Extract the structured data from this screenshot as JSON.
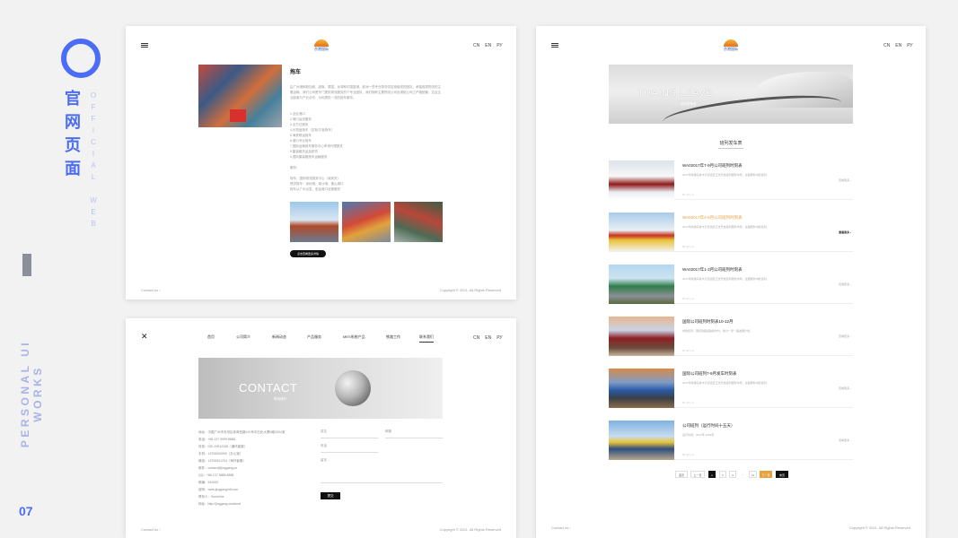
{
  "brand": {
    "cn_title": [
      "官",
      "网",
      "页",
      "面"
    ],
    "en_vertical": [
      "O",
      "F",
      "F",
      "I",
      "C",
      "I",
      "A",
      "L",
      "",
      "W",
      "E",
      "B"
    ],
    "side_label": "PERSONAL UI WORKS",
    "page_number": "07",
    "accent": "#4a6cf7"
  },
  "common": {
    "logo_text": "京港国际",
    "langs": [
      "CN",
      "EN",
      "РУ"
    ],
    "contact_us": "Contact us  ›",
    "copyright": "Copyright © 2021. All Rights Reserved"
  },
  "product_page": {
    "title": "拖车",
    "intro": "由广州港和新加坡、越南、泰国、台湾和中国香港、欧洲一些专业物流供应商组成的团队，承接各类物流的主要运输，我们公司是专门提供物流服务的个专业团队，我们拥有主要物流公司及港航公司之严格团管，拉近企业距离与产业合作，为你提供一流的拖车服务。",
    "list": [
      "1.全区港口",
      "2.港口运送服务",
      "3.全方位服务",
      "4.长短途拖车（吉柜/平板拖车）",
      "5.海铁联运拖车",
      "6.港口专业拖车",
      "7.国际运输拖车服务中心申请代理报关",
      "8.集装箱托运及卸货",
      "9.国际集装箱拖车运输服务",
      "",
      "服务：",
      "",
      "拖车：国际物流服务中心（深圳关）",
      "提供拖车：深圳港、南沙港、佛山港口",
      "拖车从广州出发，宏运港口全程服务"
    ],
    "more_button": "点击查看更多详情"
  },
  "contact_page": {
    "nav": [
      "首页",
      "公司简介",
      "新闻动态",
      "产品服务",
      "MES系统产品",
      "铁路工作",
      "联系我们"
    ],
    "active_nav": "联系我们",
    "banner_title": "CONTACT",
    "banner_sub": "联系我们",
    "info": [
      "地址：中国广州市天河区体育西路191号中石化大厦B座2004室",
      "电话：+86 137 9999 8888",
      "传真：020-29012345（通讯客服）",
      "手机：13700000000（办公室）",
      "微信：13700001234（海外客服）",
      "邮件：contact@jinggang.cn",
      "QQ：+86 137 8888 8888",
      "邮编：510000",
      "官网：www.jinggangintl.com",
      "联系人：Sunshine",
      "网址：http://jinggang.cn/about"
    ],
    "fields": {
      "name": "姓名",
      "phone": "邮箱",
      "email": "电话",
      "message": "留言..."
    },
    "submit": "提交"
  },
  "news_page": {
    "banner_title": "THAINS LEAVE",
    "banner_sub": "班列发车表",
    "section_title": "班列发车表",
    "items": [
      {
        "title": "WA02017年7-9月公司班列时刻表",
        "desc": "2017年新疆乌鲁木齐自治区正式开启班列服务市场，全面服务中欧班列。",
        "date": "07-17 | ur",
        "read": "查看更多 ›"
      },
      {
        "title": "WA02017年4-6月公司班列时刻表",
        "desc": "2017年新疆乌鲁木齐自治区正式开启班列服务市场，全面服务中欧班列。",
        "date": "07-17 | ur",
        "read": "查看更多 ›"
      },
      {
        "title": "WA02017年1-3月公司班列时刻表",
        "desc": "2017年新疆乌鲁木齐自治区正式开启班列服务市场，全面服务中欧班列。",
        "date": "07-17 | ur",
        "read": "查看更多 ›"
      },
      {
        "title": "国际公司班列时刻表10-12月",
        "desc": "中欧班列，国际铁路运输新时代，助力一带一路发展计划。",
        "date": "07-17 | ur",
        "read": "查看更多 ›"
      },
      {
        "title": "国际公司班列7-9月发车时刻表",
        "desc": "2017年新疆乌鲁木齐自治区正式开启班列服务市场，全面服务中欧班列。",
        "date": "07-17 | ur",
        "read": "查看更多 ›"
      },
      {
        "title": "公司班列（运行时间十五天）",
        "desc": "运行时间：2017年-2019年",
        "date": "07-17 | ur",
        "read": "查看更多 ›"
      }
    ],
    "highlight_index": 1,
    "pager": [
      "首页",
      "上一页",
      "1",
      "2",
      "3",
      "...",
      "11",
      "下一页",
      "末页"
    ]
  }
}
